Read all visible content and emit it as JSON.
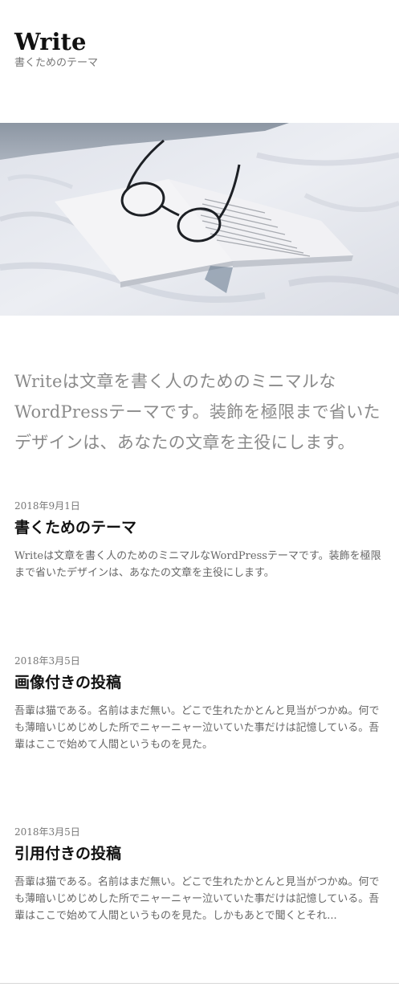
{
  "site": {
    "title": "Write",
    "description": "書くためのテーマ"
  },
  "hero": {
    "icon": "book-with-glasses-image"
  },
  "intro": {
    "text": "Writeは文章を書く人のためのミニマルなWordPressテーマです。装飾を極限まで省いたデザインは、あなたの文章を主役にします。"
  },
  "posts": [
    {
      "date": "2018年9月1日",
      "title": "書くためのテーマ",
      "excerpt": "Writeは文章を書く人のためのミニマルなWordPressテーマです。装飾を極限まで省いたデザインは、あなたの文章を主役にします。"
    },
    {
      "date": "2018年3月5日",
      "title": "画像付きの投稿",
      "excerpt": "吾輩は猫である。名前はまだ無い。どこで生れたかとんと見当がつかぬ。何でも薄暗いじめじめした所でニャーニャー泣いていた事だけは記憶している。吾輩はここで始めて人間というものを見た。"
    },
    {
      "date": "2018年3月5日",
      "title": "引用付きの投稿",
      "excerpt": "吾輩は猫である。名前はまだ無い。どこで生れたかとんと見当がつかぬ。何でも薄暗いじめじめした所でニャーニャー泣いていた事だけは記憶している。吾輩はここで始めて人間というものを見た。しかもあとで聞くとそれ..."
    }
  ]
}
